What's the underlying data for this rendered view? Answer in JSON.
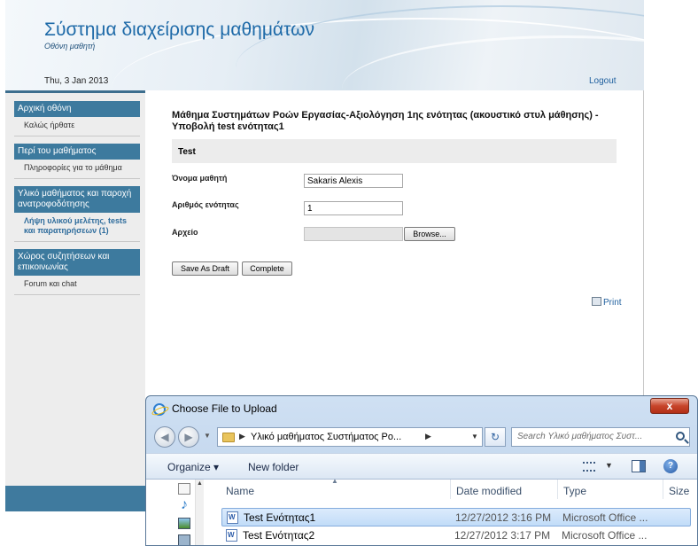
{
  "site": {
    "title": "Σύστημα διαχείρισης μαθημάτων",
    "subtitle": "Οθόνη μαθητή",
    "date": "Thu, 3 Jan 2013",
    "logout_label": "Logout"
  },
  "sidebar": {
    "sections": [
      {
        "heading": "Αρχική οθόνη",
        "items": [
          "Καλώς ήρθατε"
        ]
      },
      {
        "heading": "Περί του μαθήματος",
        "items": [
          "Πληροφορίες για το μάθημα"
        ]
      },
      {
        "heading": "Υλικό μαθήματος και παροχή ανατροφοδότησης",
        "items": [
          "Λήψη υλικού μελέτης, tests και παρατηρήσεων (1)"
        ]
      },
      {
        "heading": "Χώρος συζητήσεων και επικοινωνίας",
        "items": [
          "Forum και chat"
        ]
      }
    ]
  },
  "main": {
    "title": "Μάθημα Συστημάτων Ροών Εργασίας-Αξιολόγηση 1ης ενότητας (ακουστικό στυλ μάθησης) - Υποβολή test ενότητας1",
    "section_label": "Test",
    "fields": {
      "student_name_label": "Όνομα μαθητή",
      "student_name_value": "Sakaris Alexis",
      "unit_number_label": "Αριθμός ενότητας",
      "unit_number_value": "1",
      "file_label": "Αρχείο",
      "browse_label": "Browse..."
    },
    "buttons": {
      "save_draft": "Save As Draft",
      "complete": "Complete"
    },
    "print_label": "Print"
  },
  "dialog": {
    "title": "Choose File to Upload",
    "close_label": "x",
    "address_path": "Υλικό μαθήματος Συστήματος Ρο...",
    "search_placeholder": "Search Υλικό μαθήματος Συστ...",
    "toolbar": {
      "organize": "Organize ▾",
      "new_folder": "New folder"
    },
    "columns": {
      "name": "Name",
      "date": "Date modified",
      "type": "Type",
      "size": "Size"
    },
    "files": [
      {
        "name": "Test Ενότητας1",
        "date": "12/27/2012 3:16 PM",
        "type": "Microsoft Office ...",
        "selected": true
      },
      {
        "name": "Test Ενότητας2",
        "date": "12/27/2012 3:17 PM",
        "type": "Microsoft Office ...",
        "selected": false
      }
    ]
  },
  "colors": {
    "accent": "#3d7a9e",
    "title_blue": "#1e6aa8",
    "link_blue": "#1e5f9e",
    "dialog_frame": "#b9cfe8",
    "close_red": "#c7442a"
  }
}
